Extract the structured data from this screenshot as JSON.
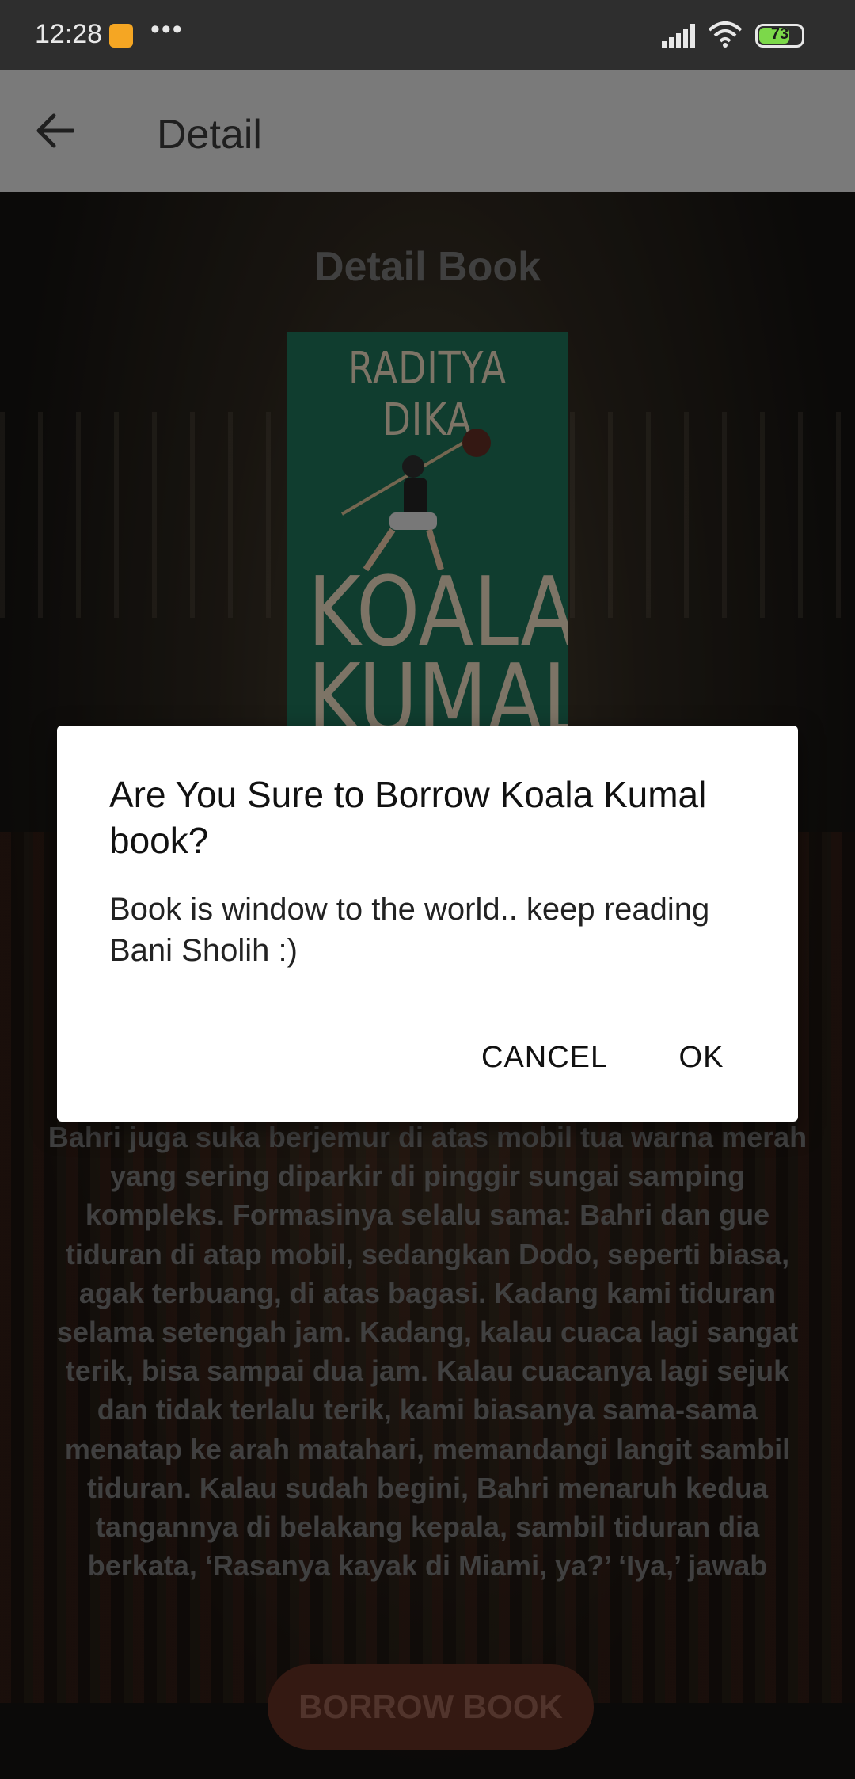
{
  "status_bar": {
    "time": "12:28",
    "dots": "•••",
    "battery": "73",
    "colors": {
      "notification": "#f5a623",
      "battery_fill": "#7cd84a"
    }
  },
  "app_bar": {
    "title": "Detail",
    "back_icon": "arrow-left-icon"
  },
  "main": {
    "heading": "Detail Book",
    "cover": {
      "author": "RADITYA DIKA",
      "title": "KOALA KUMAL"
    },
    "description": "Bahri juga suka berjemur di atas mobil tua warna merah yang sering diparkir di pinggir sungai samping kompleks. Formasinya selalu sama: Bahri dan gue tiduran di atap mobil, sedangkan Dodo, seperti biasa, agak terbuang, di atas bagasi. Kadang kami tiduran selama setengah jam. Kadang, kalau cuaca lagi sangat terik, bisa sampai dua jam. Kalau cuacanya lagi sejuk dan tidak terlalu terik, kami biasanya sama-sama menatap ke arah matahari, memandangi langit sambil tiduran. Kalau sudah begini, Bahri menaruh kedua tangannya di belakang kepala, sambil tiduran dia berkata, ‘Rasanya kayak di Miami, ya?’ ‘Iya,’ jawab",
    "borrow_button": "BORROW BOOK"
  },
  "dialog": {
    "title": "Are You Sure to Borrow Koala Kumal book?",
    "message": "Book  is window to the world.. keep reading Bani Sholih :)",
    "cancel_label": "CANCEL",
    "ok_label": "OK"
  }
}
